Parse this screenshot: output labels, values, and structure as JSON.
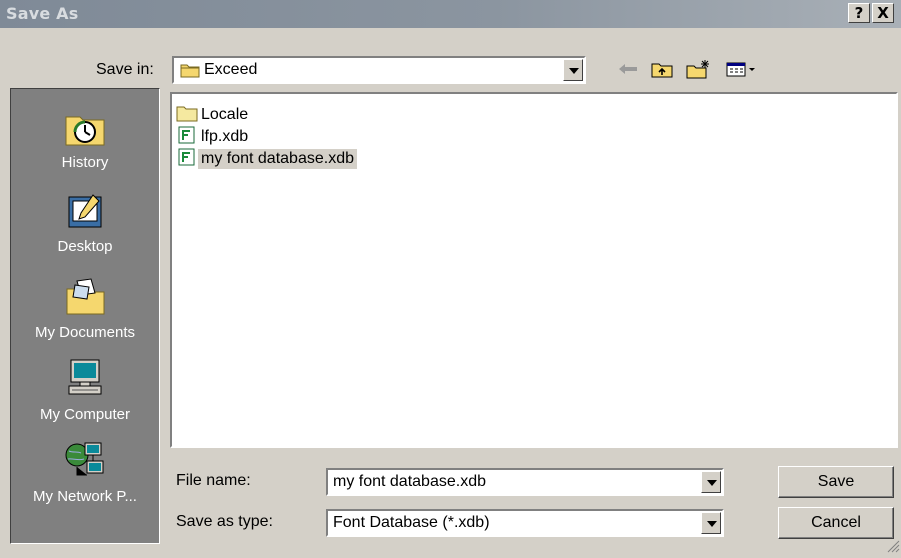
{
  "window": {
    "title": "Save As",
    "help_glyph": "?",
    "close_glyph": "X"
  },
  "toolbar": {
    "save_in_label": "Save in:",
    "save_in_value": "Exceed",
    "icons": [
      "back-arrow-icon",
      "up-one-level-icon",
      "create-new-folder-icon",
      "view-menu-icon"
    ]
  },
  "places": [
    {
      "label": "History",
      "icon": "history-icon"
    },
    {
      "label": "Desktop",
      "icon": "desktop-icon"
    },
    {
      "label": "My Documents",
      "icon": "my-documents-icon"
    },
    {
      "label": "My Computer",
      "icon": "my-computer-icon"
    },
    {
      "label": "My Network P...",
      "icon": "my-network-places-icon"
    }
  ],
  "files": [
    {
      "name": "Locale",
      "type": "folder",
      "icon": "folder-icon"
    },
    {
      "name": "lfp.xdb",
      "type": "xdb",
      "icon": "xdb-file-icon"
    },
    {
      "name": "my font database.xdb",
      "type": "xdb",
      "icon": "xdb-file-icon",
      "selected": true
    }
  ],
  "form": {
    "file_name_label": "File name:",
    "file_name_value": "my font database.xdb",
    "save_as_type_label": "Save as type:",
    "save_as_type_value": "Font Database (*.xdb)"
  },
  "buttons": {
    "save": "Save",
    "cancel": "Cancel"
  },
  "colors": {
    "dialog_bg": "#d4d0c8",
    "places_bg": "#808080",
    "titlebar": "#8b95a0",
    "folder": "#f5d76e"
  }
}
